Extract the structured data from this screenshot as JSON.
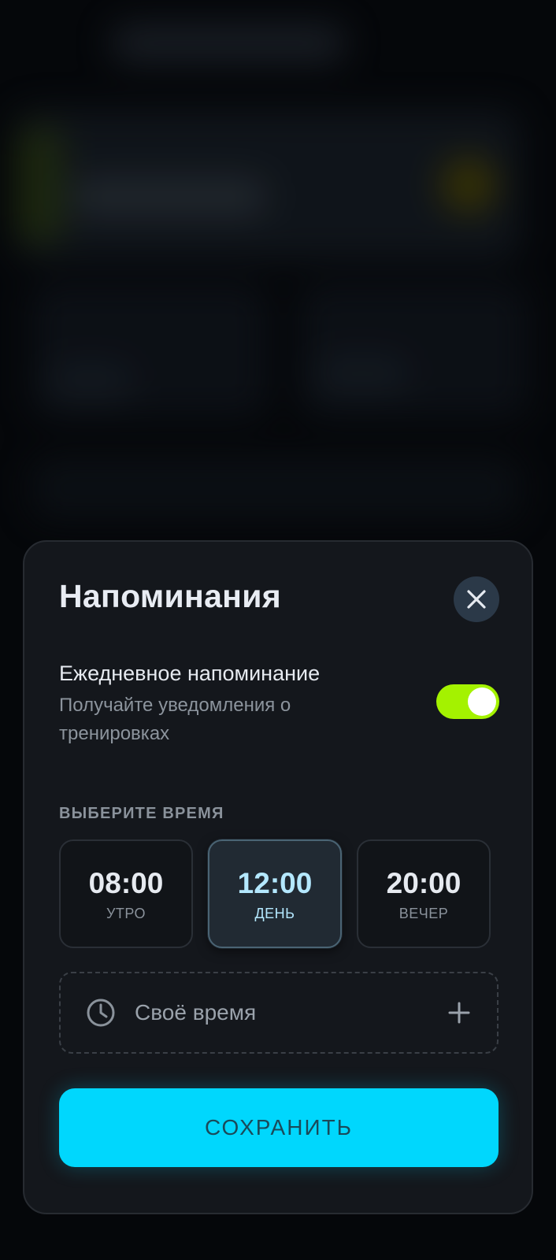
{
  "sheet": {
    "title": "Напоминания",
    "close_icon": "close-icon",
    "daily_reminder": {
      "label": "Ежедневное напоминание",
      "description": "Получайте уведомления о тренировках",
      "enabled": true
    },
    "section_label": "ВЫБЕРИТЕ ВРЕМЯ",
    "time_options": [
      {
        "time": "08:00",
        "caption": "УТРО",
        "selected": false
      },
      {
        "time": "12:00",
        "caption": "ДЕНЬ",
        "selected": true
      },
      {
        "time": "20:00",
        "caption": "ВЕЧЕР",
        "selected": false
      }
    ],
    "custom_time": {
      "label": "Своё время",
      "icon": "clock-icon",
      "action_icon": "plus-icon"
    },
    "save_label": "СОХРАНИТЬ"
  },
  "colors": {
    "accent_cyan": "#00d7fd",
    "toggle_on": "#a4f200",
    "sheet_bg": "#14171c",
    "selected_time_text": "#b4e8ff"
  }
}
